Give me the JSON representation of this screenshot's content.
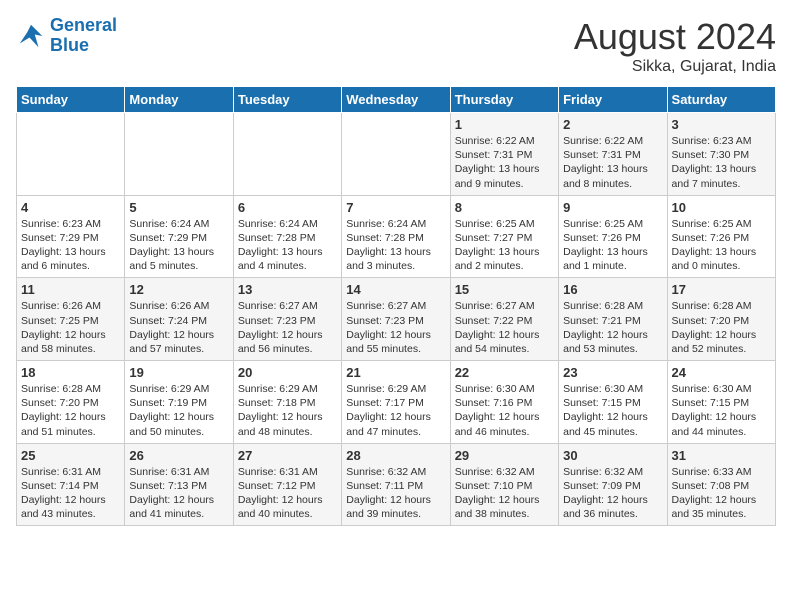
{
  "header": {
    "logo_line1": "General",
    "logo_line2": "Blue",
    "month_year": "August 2024",
    "location": "Sikka, Gujarat, India"
  },
  "days_of_week": [
    "Sunday",
    "Monday",
    "Tuesday",
    "Wednesday",
    "Thursday",
    "Friday",
    "Saturday"
  ],
  "weeks": [
    [
      {
        "day": "",
        "info": ""
      },
      {
        "day": "",
        "info": ""
      },
      {
        "day": "",
        "info": ""
      },
      {
        "day": "",
        "info": ""
      },
      {
        "day": "1",
        "info": "Sunrise: 6:22 AM\nSunset: 7:31 PM\nDaylight: 13 hours and 9 minutes."
      },
      {
        "day": "2",
        "info": "Sunrise: 6:22 AM\nSunset: 7:31 PM\nDaylight: 13 hours and 8 minutes."
      },
      {
        "day": "3",
        "info": "Sunrise: 6:23 AM\nSunset: 7:30 PM\nDaylight: 13 hours and 7 minutes."
      }
    ],
    [
      {
        "day": "4",
        "info": "Sunrise: 6:23 AM\nSunset: 7:29 PM\nDaylight: 13 hours and 6 minutes."
      },
      {
        "day": "5",
        "info": "Sunrise: 6:24 AM\nSunset: 7:29 PM\nDaylight: 13 hours and 5 minutes."
      },
      {
        "day": "6",
        "info": "Sunrise: 6:24 AM\nSunset: 7:28 PM\nDaylight: 13 hours and 4 minutes."
      },
      {
        "day": "7",
        "info": "Sunrise: 6:24 AM\nSunset: 7:28 PM\nDaylight: 13 hours and 3 minutes."
      },
      {
        "day": "8",
        "info": "Sunrise: 6:25 AM\nSunset: 7:27 PM\nDaylight: 13 hours and 2 minutes."
      },
      {
        "day": "9",
        "info": "Sunrise: 6:25 AM\nSunset: 7:26 PM\nDaylight: 13 hours and 1 minute."
      },
      {
        "day": "10",
        "info": "Sunrise: 6:25 AM\nSunset: 7:26 PM\nDaylight: 13 hours and 0 minutes."
      }
    ],
    [
      {
        "day": "11",
        "info": "Sunrise: 6:26 AM\nSunset: 7:25 PM\nDaylight: 12 hours and 58 minutes."
      },
      {
        "day": "12",
        "info": "Sunrise: 6:26 AM\nSunset: 7:24 PM\nDaylight: 12 hours and 57 minutes."
      },
      {
        "day": "13",
        "info": "Sunrise: 6:27 AM\nSunset: 7:23 PM\nDaylight: 12 hours and 56 minutes."
      },
      {
        "day": "14",
        "info": "Sunrise: 6:27 AM\nSunset: 7:23 PM\nDaylight: 12 hours and 55 minutes."
      },
      {
        "day": "15",
        "info": "Sunrise: 6:27 AM\nSunset: 7:22 PM\nDaylight: 12 hours and 54 minutes."
      },
      {
        "day": "16",
        "info": "Sunrise: 6:28 AM\nSunset: 7:21 PM\nDaylight: 12 hours and 53 minutes."
      },
      {
        "day": "17",
        "info": "Sunrise: 6:28 AM\nSunset: 7:20 PM\nDaylight: 12 hours and 52 minutes."
      }
    ],
    [
      {
        "day": "18",
        "info": "Sunrise: 6:28 AM\nSunset: 7:20 PM\nDaylight: 12 hours and 51 minutes."
      },
      {
        "day": "19",
        "info": "Sunrise: 6:29 AM\nSunset: 7:19 PM\nDaylight: 12 hours and 50 minutes."
      },
      {
        "day": "20",
        "info": "Sunrise: 6:29 AM\nSunset: 7:18 PM\nDaylight: 12 hours and 48 minutes."
      },
      {
        "day": "21",
        "info": "Sunrise: 6:29 AM\nSunset: 7:17 PM\nDaylight: 12 hours and 47 minutes."
      },
      {
        "day": "22",
        "info": "Sunrise: 6:30 AM\nSunset: 7:16 PM\nDaylight: 12 hours and 46 minutes."
      },
      {
        "day": "23",
        "info": "Sunrise: 6:30 AM\nSunset: 7:15 PM\nDaylight: 12 hours and 45 minutes."
      },
      {
        "day": "24",
        "info": "Sunrise: 6:30 AM\nSunset: 7:15 PM\nDaylight: 12 hours and 44 minutes."
      }
    ],
    [
      {
        "day": "25",
        "info": "Sunrise: 6:31 AM\nSunset: 7:14 PM\nDaylight: 12 hours and 43 minutes."
      },
      {
        "day": "26",
        "info": "Sunrise: 6:31 AM\nSunset: 7:13 PM\nDaylight: 12 hours and 41 minutes."
      },
      {
        "day": "27",
        "info": "Sunrise: 6:31 AM\nSunset: 7:12 PM\nDaylight: 12 hours and 40 minutes."
      },
      {
        "day": "28",
        "info": "Sunrise: 6:32 AM\nSunset: 7:11 PM\nDaylight: 12 hours and 39 minutes."
      },
      {
        "day": "29",
        "info": "Sunrise: 6:32 AM\nSunset: 7:10 PM\nDaylight: 12 hours and 38 minutes."
      },
      {
        "day": "30",
        "info": "Sunrise: 6:32 AM\nSunset: 7:09 PM\nDaylight: 12 hours and 36 minutes."
      },
      {
        "day": "31",
        "info": "Sunrise: 6:33 AM\nSunset: 7:08 PM\nDaylight: 12 hours and 35 minutes."
      }
    ]
  ]
}
